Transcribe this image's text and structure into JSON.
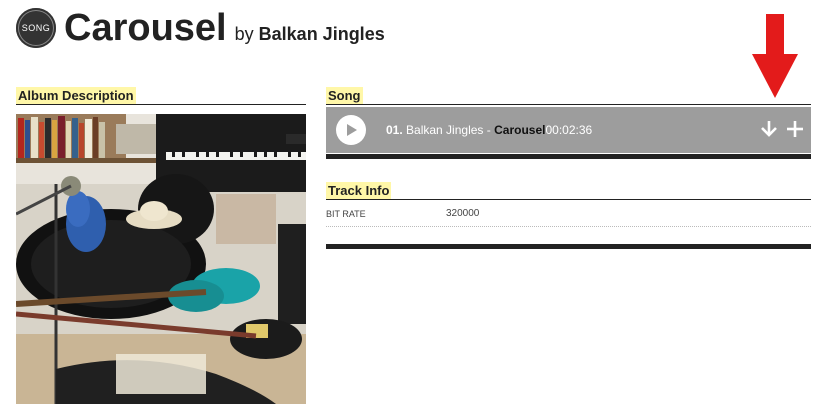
{
  "header": {
    "badge": "SONG",
    "title": "Carousel",
    "by_word": "by",
    "artist": "Balkan Jingles"
  },
  "album": {
    "section_label": "Album Description"
  },
  "song": {
    "section_label": "Song",
    "track_number": "01.",
    "artist": "Balkan Jingles",
    "separator": "-",
    "title": "Carousel",
    "duration": "00:02:36"
  },
  "track_info": {
    "section_label": "Track Info",
    "rows": [
      {
        "key": "BIT RATE",
        "value": "320000"
      }
    ]
  },
  "icons": {
    "badge": "song-badge-icon",
    "play": "play-icon",
    "download": "download-icon",
    "add": "plus-icon",
    "annotation": "red-arrow-icon"
  },
  "colors": {
    "song_bar": "#9d9d9d",
    "highlight": "#fff7a8",
    "annotation_red": "#e31b1b"
  }
}
